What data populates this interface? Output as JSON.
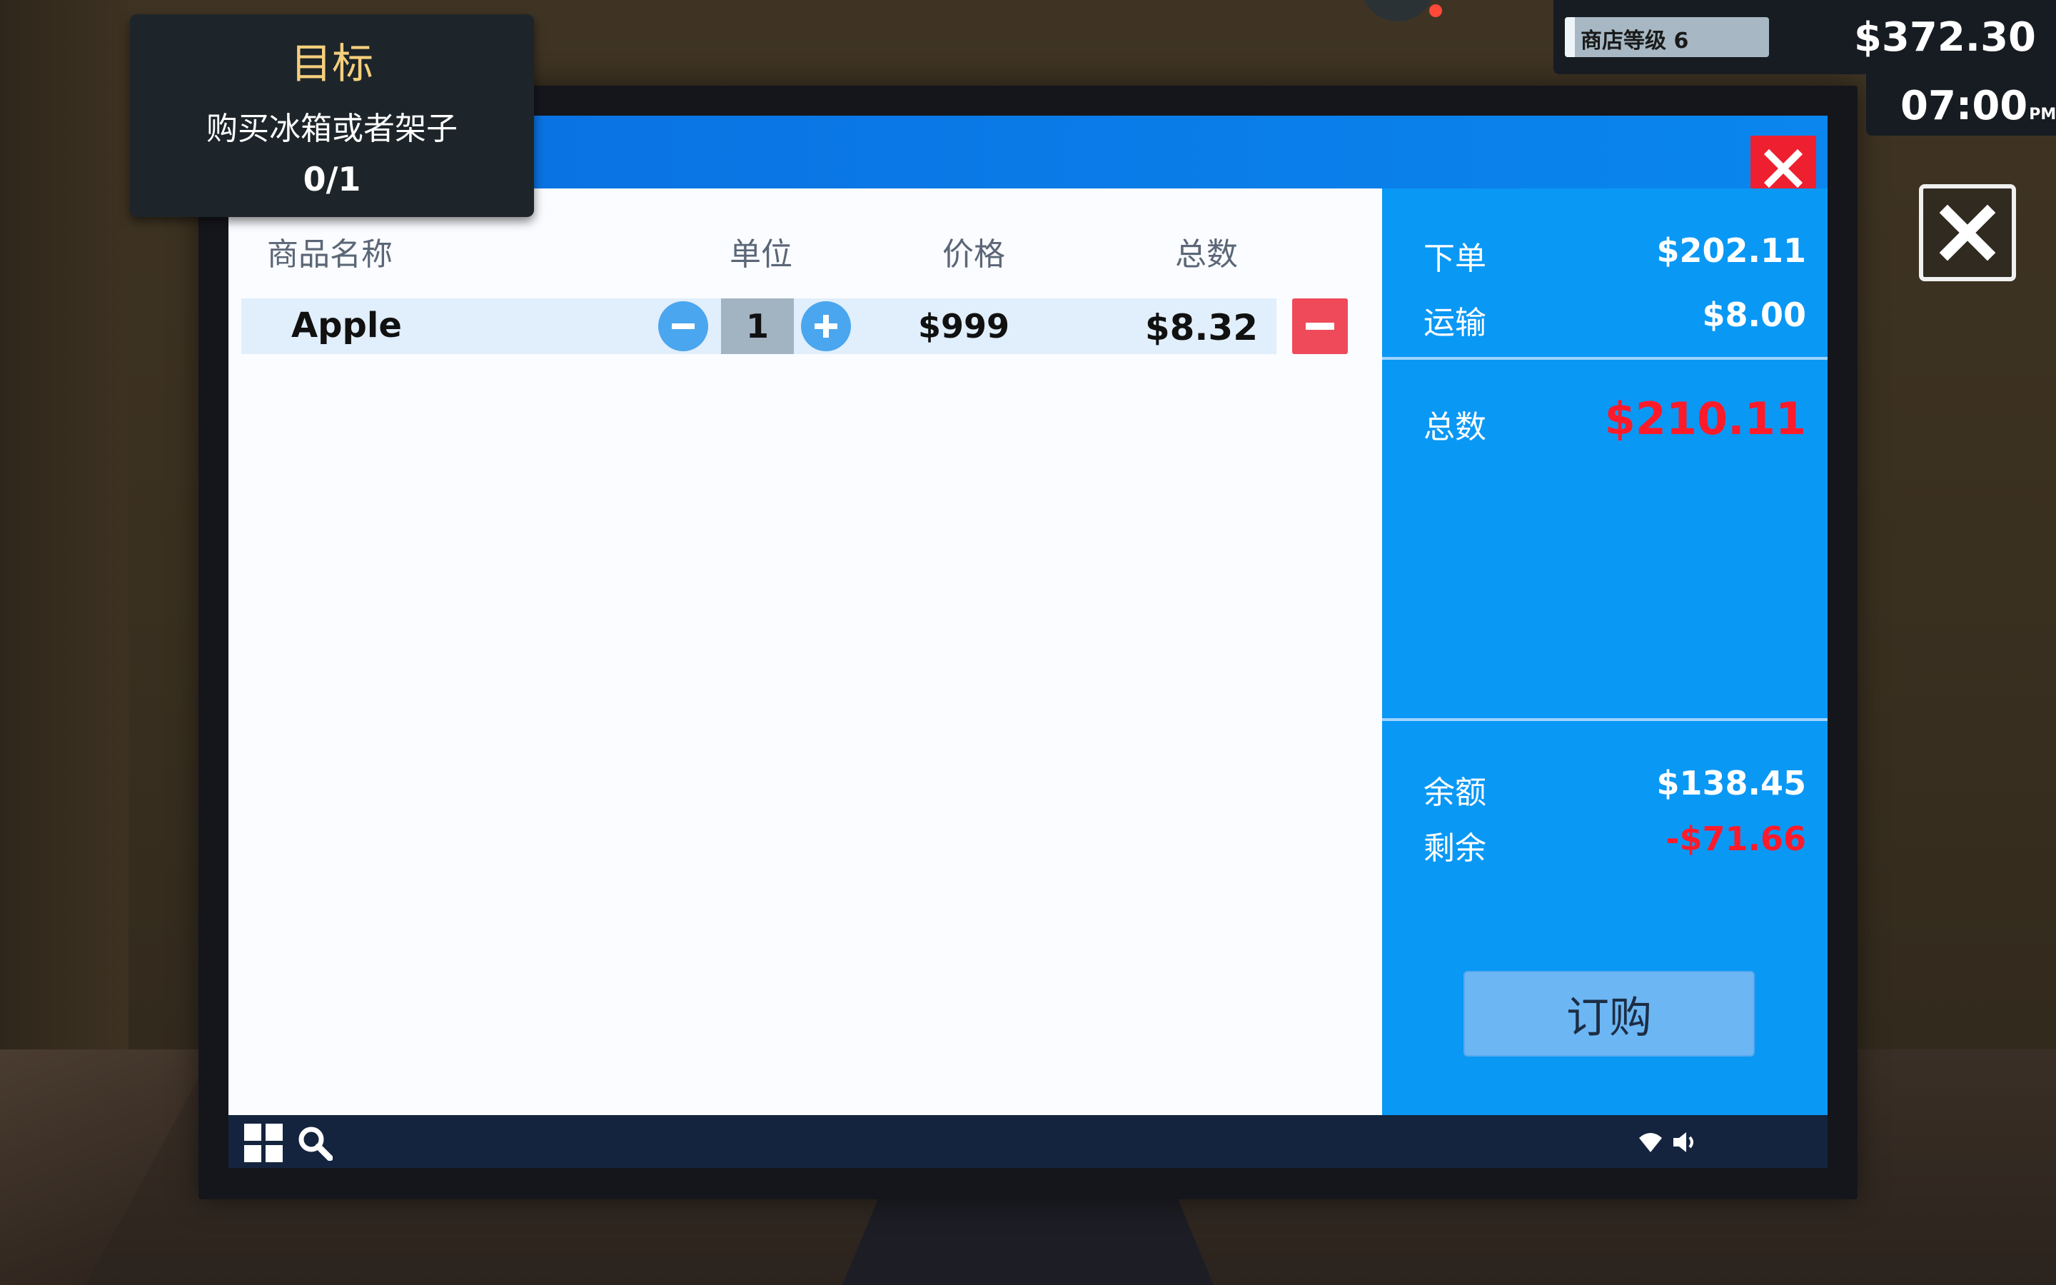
{
  "goal": {
    "title": "目标",
    "description": "购买冰箱或者架子",
    "progress": "0/1"
  },
  "hud": {
    "store_level_label": "商店等级 6",
    "store_level_progress": 0.05,
    "money": "$372.30",
    "time": "07:00",
    "time_period": "PM"
  },
  "table": {
    "headers": {
      "name": "商品名称",
      "unit": "单位",
      "price": "价格",
      "total": "总数"
    },
    "rows": [
      {
        "name": "Apple",
        "quantity": "1",
        "price": "$999",
        "total": "$8.32"
      }
    ]
  },
  "summary": {
    "order_label": "下单",
    "order_value": "$202.11",
    "shipping_label": "运输",
    "shipping_value": "$8.00",
    "total_label": "总数",
    "total_value": "$210.11",
    "balance_label": "余额",
    "balance_value": "$138.45",
    "remaining_label": "剩余",
    "remaining_value": "-$71.66",
    "order_button": "订购"
  },
  "icons": {
    "close": "close-icon",
    "minus": "minus-icon",
    "plus": "plus-icon",
    "remove": "remove-icon",
    "apps": "grid-icon",
    "search": "search-icon",
    "wifi": "wifi-icon",
    "volume": "volume-icon"
  },
  "colors": {
    "title_bar": "#0a7ce8",
    "summary_bg": "#0a98f5",
    "negative": "#ff1a2a",
    "goal_title": "#f6cf7c",
    "close_red": "#ee2030"
  }
}
